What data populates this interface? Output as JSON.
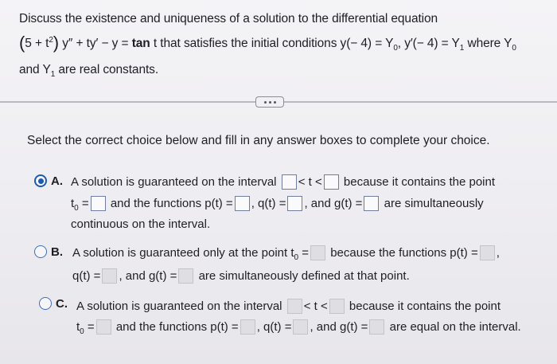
{
  "question": {
    "line1": "Discuss the existence and uniqueness of a solution to the differential equation",
    "eq_five_plus_t": "5 + t",
    "eq_exp2": "2",
    "eq_part1": "y″ + ty′ − y =",
    "eq_tan": "tan",
    "eq_part2": "t that satisfies the initial conditions y(− 4) = Y",
    "eq_sub0": "0",
    "eq_part3": ", y′(− 4) = Y",
    "eq_sub1": "1",
    "eq_part4": " where Y",
    "eq_sub0b": "0",
    "line3_part1": "and Y",
    "line3_sub1": "1",
    "line3_part2": " are real constants."
  },
  "instruction": "Select the correct choice below and fill in any answer boxes to complete your choice.",
  "choices": {
    "a": {
      "letter": "A.",
      "l1_part1": "A solution is guaranteed on the interval",
      "l1_mid": "< t <",
      "l1_part2": "because it contains the point",
      "l2_t": "t",
      "l2_sub": "0",
      "l2_eq": " =",
      "l2_part1": "and the functions p(t) =",
      "l2_q": ", q(t) =",
      "l2_g": ", and g(t) =",
      "l2_end": "are simultaneously",
      "l3": "continuous on the interval."
    },
    "b": {
      "letter": "B.",
      "l1_part1": "A solution is guaranteed only at the point t",
      "l1_sub": "0",
      "l1_eq": " =",
      "l1_part2": "because the functions p(t) =",
      "l1_comma": ",",
      "l2_q": "q(t) =",
      "l2_g": ", and g(t) =",
      "l2_end": "are simultaneously defined at that point."
    },
    "c": {
      "letter": "C.",
      "l1_part1": "A solution is guaranteed on the interval",
      "l1_mid": "< t <",
      "l1_part2": "because it contains the point",
      "l2_t": "t",
      "l2_sub": "0",
      "l2_eq": " =",
      "l2_part1": "and the functions p(t) =",
      "l2_q": ", q(t) =",
      "l2_g": ", and g(t) =",
      "l2_end": "are equal on the interval."
    }
  },
  "selected_choice": "A",
  "colors": {
    "radio_accent": "#1f5aa8",
    "box_border": "#8a8a94",
    "disabled_box": "#dfdee3"
  }
}
